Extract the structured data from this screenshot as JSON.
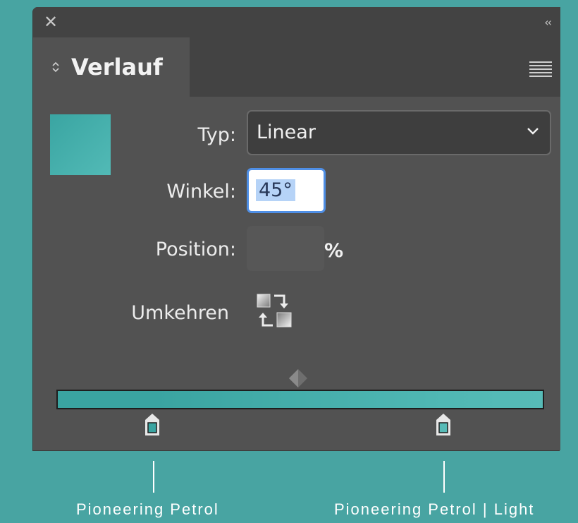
{
  "titlebar": {
    "close_icon": "close-icon",
    "collapse_label": "‹‹"
  },
  "tab": {
    "updown_icon": "updown-chevron-icon",
    "title": "Verlauf"
  },
  "menu_icon": "panel-menu-icon",
  "swatch": {
    "colors": [
      "#3aa5a2",
      "#52bab6"
    ]
  },
  "fields": {
    "type_label": "Typ:",
    "type_value": "Linear",
    "angle_label": "Winkel:",
    "angle_value": "45°",
    "position_label": "Position:",
    "position_value": "",
    "position_unit": "%",
    "reverse_label": "Umkehren"
  },
  "gradient": {
    "stops": [
      {
        "color": "#3aa4a1",
        "location": 0.2
      },
      {
        "color": "#57bbb7",
        "location": 0.8
      }
    ]
  },
  "captions": {
    "left": "Pioneering Petrol",
    "right": "Pioneering Petrol | Light"
  },
  "colors": {
    "background": "#48a4a2",
    "panel": "#525252",
    "accent": "#4f8fe6"
  }
}
